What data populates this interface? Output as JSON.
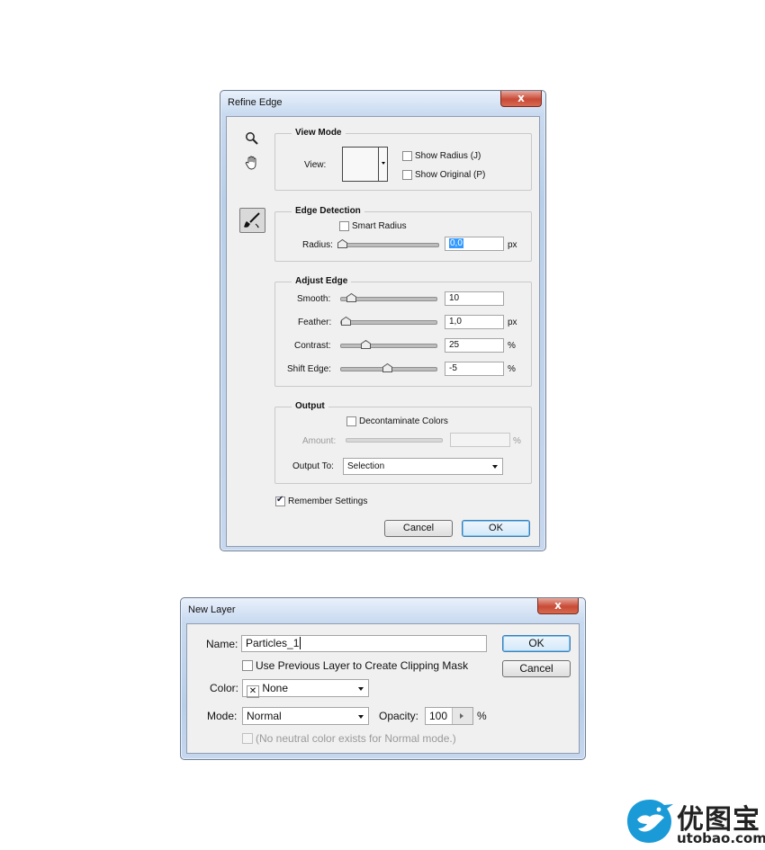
{
  "refine_edge": {
    "title": "Refine Edge",
    "close_glyph": "x",
    "view_mode": {
      "title": "View Mode",
      "view_label": "View:",
      "show_radius": "Show Radius (J)",
      "show_original": "Show Original (P)"
    },
    "edge_detection": {
      "title": "Edge Detection",
      "smart_radius": "Smart Radius",
      "radius_label": "Radius:",
      "radius_value": "0,0",
      "radius_unit": "px"
    },
    "adjust_edge": {
      "title": "Adjust Edge",
      "smooth_label": "Smooth:",
      "smooth_value": "10",
      "feather_label": "Feather:",
      "feather_value": "1,0",
      "feather_unit": "px",
      "contrast_label": "Contrast:",
      "contrast_value": "25",
      "contrast_unit": "%",
      "shift_label": "Shift Edge:",
      "shift_value": "-5",
      "shift_unit": "%"
    },
    "output": {
      "title": "Output",
      "decontaminate": "Decontaminate Colors",
      "amount_label": "Amount:",
      "amount_unit": "%",
      "output_to_label": "Output To:",
      "output_to_value": "Selection"
    },
    "remember_settings": "Remember Settings",
    "remember_checked": true,
    "cancel": "Cancel",
    "ok": "OK",
    "tools": [
      "zoom-icon",
      "hand-icon",
      "refine-radius-brush-icon"
    ]
  },
  "new_layer": {
    "title": "New Layer",
    "close_glyph": "x",
    "name_label": "Name:",
    "name_value": "Particles_1",
    "clipping_mask": "Use Previous Layer to Create Clipping Mask",
    "color_label": "Color:",
    "color_value": "None",
    "mode_label": "Mode:",
    "mode_value": "Normal",
    "opacity_label": "Opacity:",
    "opacity_value": "100",
    "opacity_unit": "%",
    "neutral_note": "(No neutral color exists for Normal mode.)",
    "ok": "OK",
    "cancel": "Cancel"
  },
  "watermark": {
    "cn": "优图宝",
    "url": "utobao.com",
    "color": "#1a9bd7"
  },
  "colors": {
    "accent": "#3399ff",
    "close_red": "#c84a36"
  }
}
